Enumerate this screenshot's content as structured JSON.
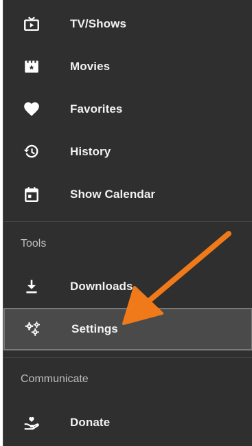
{
  "menu": {
    "items": [
      {
        "label": "TV/Shows",
        "icon": "tv-play-icon"
      },
      {
        "label": "Movies",
        "icon": "movie-film-icon"
      },
      {
        "label": "Favorites",
        "icon": "heart-icon"
      },
      {
        "label": "History",
        "icon": "history-clock-icon"
      },
      {
        "label": "Show Calendar",
        "icon": "calendar-icon"
      }
    ]
  },
  "tools": {
    "title": "Tools",
    "items": [
      {
        "label": "Downloads",
        "icon": "download-icon"
      },
      {
        "label": "Settings",
        "icon": "settings-gears-icon",
        "selected": true
      }
    ]
  },
  "communicate": {
    "title": "Communicate",
    "items": [
      {
        "label": "Donate",
        "icon": "donate-hand-heart-icon"
      }
    ]
  },
  "colors": {
    "drawer_bg": "#2f2f2f",
    "selected_bg": "#4a4a4a",
    "arrow": "#f07a1a"
  }
}
